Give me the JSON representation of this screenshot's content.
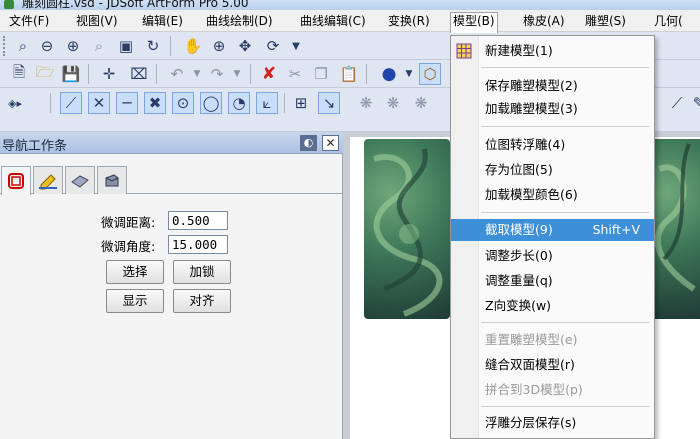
{
  "window": {
    "title": "雕刻圆柱.vsd - JDSoft ArtForm Pro 5.00"
  },
  "menubar": [
    {
      "label": "文件(F)",
      "underline": "F"
    },
    {
      "label": "视图(V)",
      "underline": "V"
    },
    {
      "label": "编辑(E)",
      "underline": "E"
    },
    {
      "label": "曲线绘制(D)",
      "underline": "D"
    },
    {
      "label": "曲线编辑(C)",
      "underline": "C"
    },
    {
      "label": "变换(R)",
      "underline": "R"
    },
    {
      "label": "模型(B)",
      "underline": "B"
    },
    {
      "label": "橡皮(A)",
      "underline": "A"
    },
    {
      "label": "雕塑(S)",
      "underline": "S"
    },
    {
      "label": "几何(",
      "underline": ""
    }
  ],
  "nav_panel": {
    "title": "导航工作条",
    "form": {
      "distance_label": "微调距离:",
      "distance_value": "0.500",
      "angle_label": "微调角度:",
      "angle_value": "15.000"
    },
    "buttons": {
      "select": "选择",
      "lock": "加锁",
      "show": "显示",
      "align": "对齐"
    }
  },
  "model_menu": {
    "items": [
      {
        "label": "新建模型(1)",
        "state": "normal",
        "icon": "grid-icon"
      },
      {
        "label": "保存雕塑模型(2)",
        "state": "normal"
      },
      {
        "label": "加载雕塑模型(3)",
        "state": "normal"
      },
      {
        "label": "位图转浮雕(4)",
        "state": "normal"
      },
      {
        "label": "存为位图(5)",
        "state": "normal"
      },
      {
        "label": "加载模型颜色(6)",
        "state": "normal"
      },
      {
        "label": "截取模型(9)",
        "shortcut": "Shift+V",
        "state": "highlighted"
      },
      {
        "label": "调整步长(0)",
        "state": "normal"
      },
      {
        "label": "调整重量(q)",
        "state": "normal"
      },
      {
        "label": "Z向变换(w)",
        "state": "normal"
      },
      {
        "label": "重置雕塑模型(e)",
        "state": "disabled"
      },
      {
        "label": "缝合双面模型(r)",
        "state": "normal"
      },
      {
        "label": "拼合到3D模型(p)",
        "state": "disabled"
      },
      {
        "label": "浮雕分层保存(s)",
        "state": "normal"
      }
    ]
  },
  "colors": {
    "highlight": "#3d8fd8",
    "disabled_text": "#9a9a9a",
    "relief_green": "#3f7a5a"
  }
}
